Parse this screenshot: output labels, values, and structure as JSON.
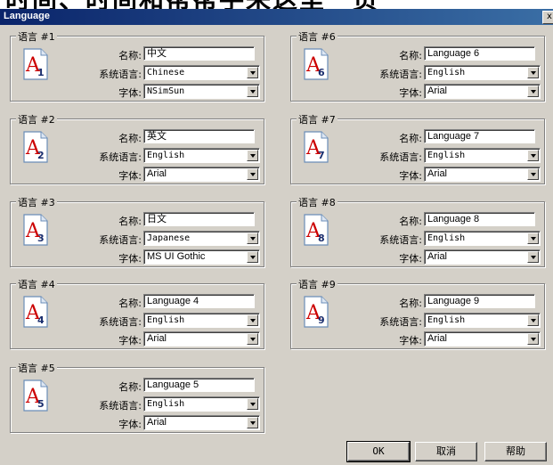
{
  "window": {
    "title": "Language",
    "close_glyph": "x"
  },
  "labels": {
    "name": "名称:",
    "system_language": "系统语言:",
    "font": "字体:"
  },
  "icon": {
    "name": "language-document-icon",
    "letter": "A",
    "color": "#cc0000"
  },
  "groups": [
    {
      "title": "语言 #1",
      "number": "1",
      "name_value": "中文",
      "system_language": "Chinese",
      "font": "NSimSun"
    },
    {
      "title": "语言 #2",
      "number": "2",
      "name_value": "英文",
      "system_language": "English",
      "font": "Arial"
    },
    {
      "title": "语言 #3",
      "number": "3",
      "name_value": "日文",
      "system_language": "Japanese",
      "font": "MS UI Gothic"
    },
    {
      "title": "语言 #4",
      "number": "4",
      "name_value": "Language 4",
      "system_language": "English",
      "font": "Arial"
    },
    {
      "title": "语言 #5",
      "number": "5",
      "name_value": "Language 5",
      "system_language": "English",
      "font": "Arial"
    },
    {
      "title": "语言 #6",
      "number": "6",
      "name_value": "Language 6",
      "system_language": "English",
      "font": "Arial"
    },
    {
      "title": "语言 #7",
      "number": "7",
      "name_value": "Language 7",
      "system_language": "English",
      "font": "Arial"
    },
    {
      "title": "语言 #8",
      "number": "8",
      "name_value": "Language 8",
      "system_language": "English",
      "font": "Arial"
    },
    {
      "title": "语言 #9",
      "number": "9",
      "name_value": "Language 9",
      "system_language": "English",
      "font": "Arial"
    }
  ],
  "buttons": {
    "ok": "OK",
    "cancel": "取消",
    "help": "帮助"
  }
}
